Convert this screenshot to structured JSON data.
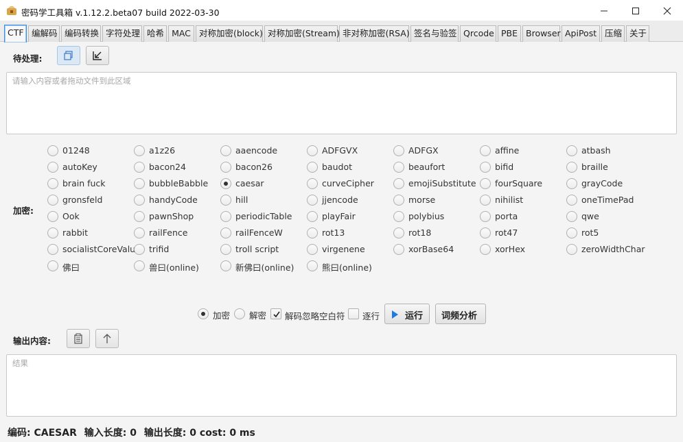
{
  "window": {
    "title": "密码学工具箱 v.1.12.2.beta07 build 2022-03-30"
  },
  "tabs": [
    {
      "label": "CTF",
      "active": true
    },
    {
      "label": "编解码"
    },
    {
      "label": "编码转换"
    },
    {
      "label": "字符处理"
    },
    {
      "label": "哈希"
    },
    {
      "label": "MAC"
    },
    {
      "label": "对称加密(block)"
    },
    {
      "label": "对称加密(Stream)"
    },
    {
      "label": "非对称加密(RSA)"
    },
    {
      "label": "签名与验签"
    },
    {
      "label": "Qrcode"
    },
    {
      "label": "PBE"
    },
    {
      "label": "Browser"
    },
    {
      "label": "ApiPost"
    },
    {
      "label": "压缩"
    },
    {
      "label": "关于"
    }
  ],
  "input": {
    "label": "待处理:",
    "placeholder": "请输入内容或者拖动文件到此区域"
  },
  "encrypt": {
    "label": "加密:",
    "selected": "caesar",
    "options": [
      "01248",
      "a1z26",
      "aaencode",
      "ADFGVX",
      "ADFGX",
      "affine",
      "atbash",
      "autoKey",
      "bacon24",
      "bacon26",
      "baudot",
      "beaufort",
      "bifid",
      "braille",
      "brain fuck",
      "bubbleBabble",
      "caesar",
      "curveCipher",
      "emojiSubstitute",
      "fourSquare",
      "grayCode",
      "gronsfeld",
      "handyCode",
      "hill",
      "jjencode",
      "morse",
      "nihilist",
      "oneTimePad",
      "Ook",
      "pawnShop",
      "periodicTable",
      "playFair",
      "polybius",
      "porta",
      "qwe",
      "rabbit",
      "railFence",
      "railFenceW",
      "rot13",
      "rot18",
      "rot47",
      "rot5",
      "socialistCoreValue",
      "trifid",
      "troll script",
      "virgenene",
      "xorBase64",
      "xorHex",
      "zeroWidthChar",
      "佛曰",
      "兽曰(online)",
      "新佛曰(online)",
      "熊曰(online)"
    ]
  },
  "controls": {
    "mode_encrypt": "加密",
    "mode_decrypt": "解密",
    "mode_selected": "encrypt",
    "ignore_space": "解码忽略空白符",
    "ignore_space_checked": true,
    "line_by_line": "逐行",
    "line_by_line_checked": false,
    "run": "运行",
    "freq": "词频分析"
  },
  "output": {
    "label": "输出内容:",
    "placeholder": "结果"
  },
  "status": {
    "encoding": "编码: CAESAR",
    "input_len": "输入长度: 0",
    "output_len": "输出长度: 0 cost: 0 ms"
  }
}
